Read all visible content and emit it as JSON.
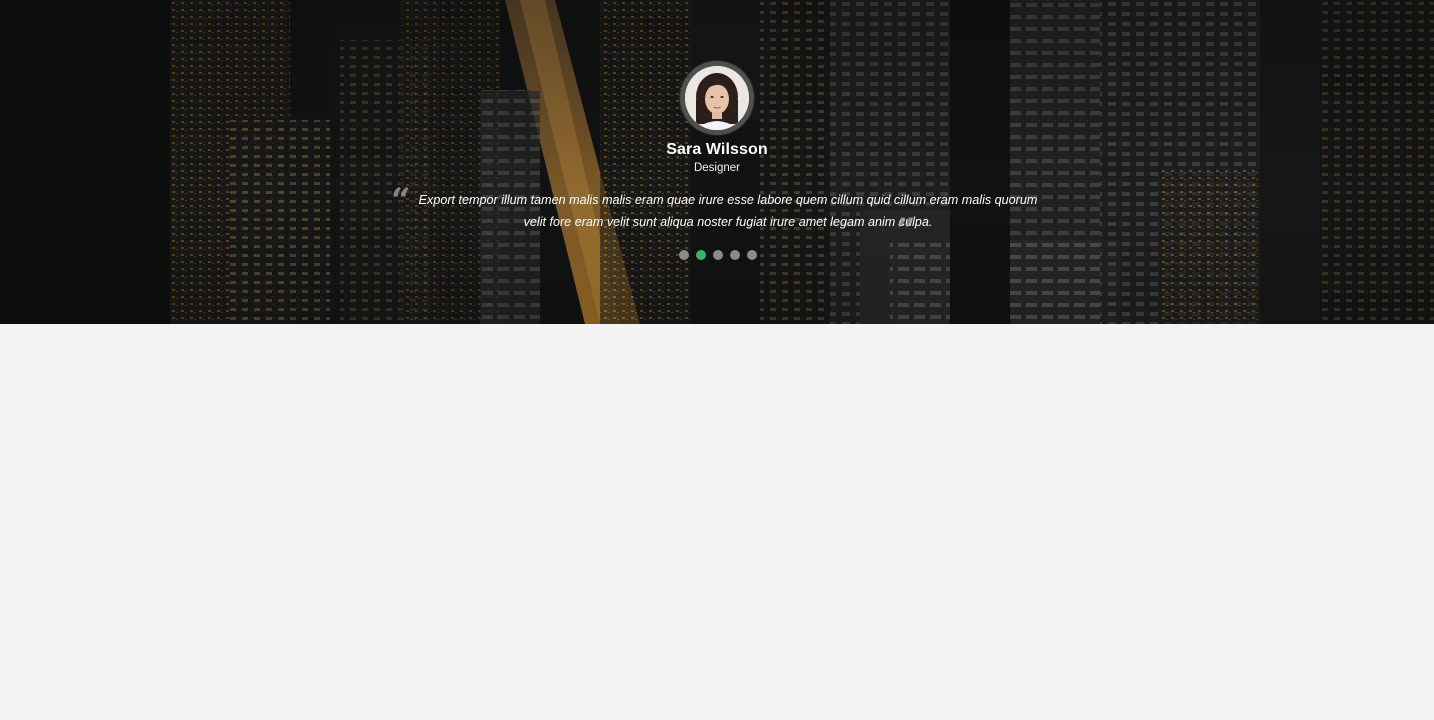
{
  "testimonial": {
    "name": "Sara Wilsson",
    "role": "Designer",
    "quote": "Export tempor illum tamen malis malis eram quae irure esse labore quem cillum quid cillum eram malis quorum velit fore eram velit sunt aliqua noster fugiat irure amet legam anim culpa.",
    "quote_open_icon": "quote-left-icon",
    "quote_close_icon": "quote-right-icon"
  },
  "carousel": {
    "slide_count": 5,
    "active_index": 1,
    "active_color": "#39b36b",
    "inactive_color": "#8a8a8a"
  },
  "colors": {
    "page_background": "#f4f4f4"
  }
}
